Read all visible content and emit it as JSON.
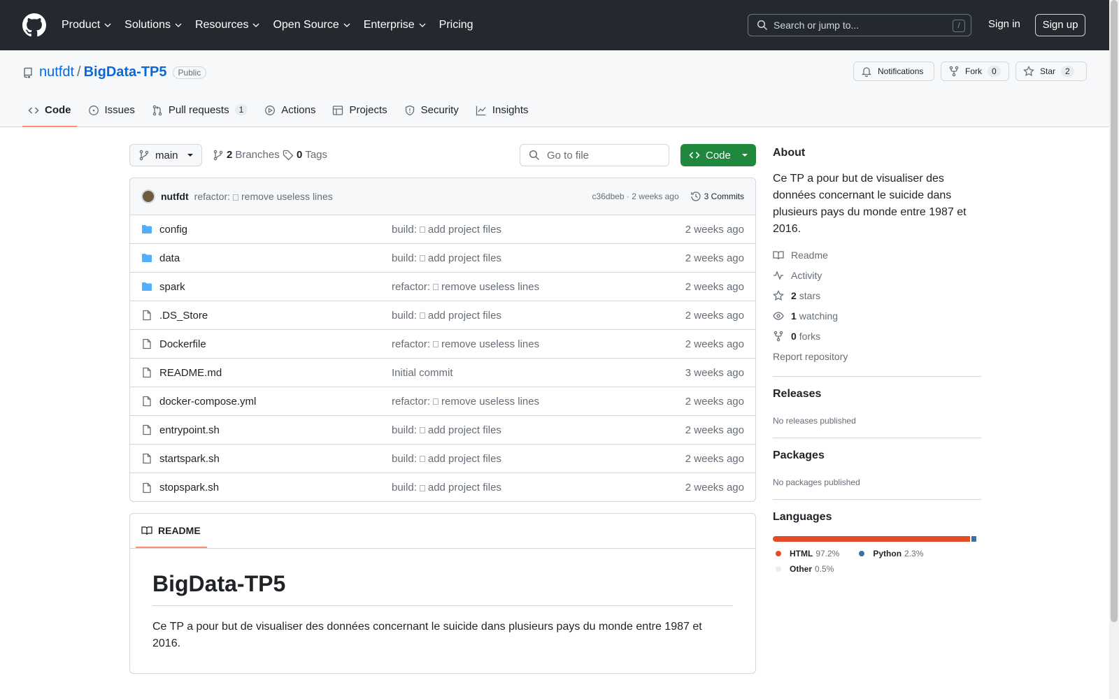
{
  "header": {
    "nav": [
      {
        "label": "Product",
        "has_chevron": true
      },
      {
        "label": "Solutions",
        "has_chevron": true
      },
      {
        "label": "Resources",
        "has_chevron": true
      },
      {
        "label": "Open Source",
        "has_chevron": true
      },
      {
        "label": "Enterprise",
        "has_chevron": true
      },
      {
        "label": "Pricing",
        "has_chevron": false
      }
    ],
    "search_placeholder": "Search or jump to...",
    "search_key": "/",
    "sign_in": "Sign in",
    "sign_up": "Sign up"
  },
  "repo": {
    "owner": "nutfdt",
    "slash": "/",
    "name": "BigData-TP5",
    "visibility": "Public",
    "notifications_label": "Notifications",
    "fork_label": "Fork",
    "fork_count": "0",
    "star_label": "Star",
    "star_count": "2",
    "tabs": [
      {
        "label": "Code",
        "icon": "code-icon",
        "counter": ""
      },
      {
        "label": "Issues",
        "icon": "issue-icon",
        "counter": ""
      },
      {
        "label": "Pull requests",
        "icon": "pull-request-icon",
        "counter": "1"
      },
      {
        "label": "Actions",
        "icon": "play-icon",
        "counter": ""
      },
      {
        "label": "Projects",
        "icon": "table-icon",
        "counter": ""
      },
      {
        "label": "Security",
        "icon": "shield-icon",
        "counter": ""
      },
      {
        "label": "Insights",
        "icon": "graph-icon",
        "counter": ""
      }
    ]
  },
  "toolbar": {
    "branch": "main",
    "branches_count": "2",
    "branches_label": "Branches",
    "tags_count": "0",
    "tags_label": "Tags",
    "goto_placeholder": "Go to file",
    "code_label": "Code"
  },
  "latest_commit": {
    "author": "nutfdt",
    "message_prefix": "refactor:",
    "message": "remove useless lines",
    "hash": "c36dbeb",
    "time": "2 weeks ago",
    "commits_label": "3 Commits"
  },
  "files": [
    {
      "name": "config",
      "type": "folder",
      "commit_prefix": "build:",
      "commit": "add project files",
      "has_emoji": true,
      "time": "2 weeks ago"
    },
    {
      "name": "data",
      "type": "folder",
      "commit_prefix": "build:",
      "commit": "add project files",
      "has_emoji": true,
      "time": "2 weeks ago"
    },
    {
      "name": "spark",
      "type": "folder",
      "commit_prefix": "refactor:",
      "commit": "remove useless lines",
      "has_emoji": true,
      "time": "2 weeks ago"
    },
    {
      "name": ".DS_Store",
      "type": "file",
      "commit_prefix": "build:",
      "commit": "add project files",
      "has_emoji": true,
      "time": "2 weeks ago"
    },
    {
      "name": "Dockerfile",
      "type": "file",
      "commit_prefix": "refactor:",
      "commit": "remove useless lines",
      "has_emoji": true,
      "time": "2 weeks ago"
    },
    {
      "name": "README.md",
      "type": "file",
      "commit_prefix": "",
      "commit": "Initial commit",
      "has_emoji": false,
      "time": "3 weeks ago"
    },
    {
      "name": "docker-compose.yml",
      "type": "file",
      "commit_prefix": "refactor:",
      "commit": "remove useless lines",
      "has_emoji": true,
      "time": "2 weeks ago"
    },
    {
      "name": "entrypoint.sh",
      "type": "file",
      "commit_prefix": "build:",
      "commit": "add project files",
      "has_emoji": true,
      "time": "2 weeks ago"
    },
    {
      "name": "startspark.sh",
      "type": "file",
      "commit_prefix": "build:",
      "commit": "add project files",
      "has_emoji": true,
      "time": "2 weeks ago"
    },
    {
      "name": "stopspark.sh",
      "type": "file",
      "commit_prefix": "build:",
      "commit": "add project files",
      "has_emoji": true,
      "time": "2 weeks ago"
    }
  ],
  "readme": {
    "tab_label": "README",
    "title": "BigData-TP5",
    "body": "Ce TP a pour but de visualiser des données concernant le suicide dans plusieurs pays du monde entre 1987 et 2016."
  },
  "sidebar": {
    "about_title": "About",
    "about_text": "Ce TP a pour but de visualiser des données concernant le suicide dans plusieurs pays du monde entre 1987 et 2016.",
    "readme_link": "Readme",
    "activity_link": "Activity",
    "stars_count": "2",
    "stars_label": "stars",
    "watching_count": "1",
    "watching_label": "watching",
    "forks_count": "0",
    "forks_label": "forks",
    "report_link": "Report repository",
    "releases_title": "Releases",
    "releases_text": "No releases published",
    "packages_title": "Packages",
    "packages_text": "No packages published",
    "languages_title": "Languages",
    "languages": [
      {
        "name": "HTML",
        "percent": "97.2%",
        "share": 97.2,
        "color": "#e34c26"
      },
      {
        "name": "Python",
        "percent": "2.3%",
        "share": 2.3,
        "color": "#3572a5"
      },
      {
        "name": "Other",
        "percent": "0.5%",
        "share": 0.5,
        "color": "#ededed"
      }
    ]
  },
  "colors": {
    "header_bg": "#24292f",
    "link": "#0969da",
    "green_button": "#1f883d",
    "active_tab_underline": "#fd8c73",
    "folder_icon": "#54aeff"
  }
}
